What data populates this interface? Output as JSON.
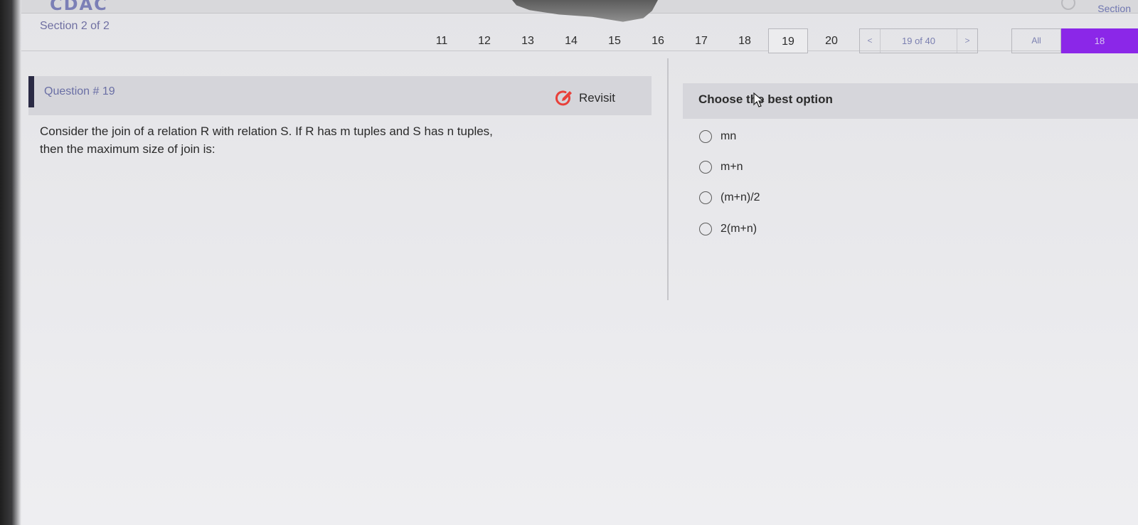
{
  "brand": {
    "logo_text": "CDAC"
  },
  "header": {
    "section_label": "Section 2 of 2",
    "section_right_label": "Section",
    "question_numbers": [
      "11",
      "12",
      "13",
      "14",
      "15",
      "16",
      "17",
      "18",
      "19",
      "20"
    ],
    "active_question": "19",
    "pager": {
      "prev": "<",
      "counter": "19 of 40",
      "next": ">"
    },
    "filter_label": "All",
    "count_value": "18"
  },
  "question": {
    "number_label": "Question # 19",
    "revisit_label": "Revisit",
    "text_line1": "Consider the join of a relation R with relation S. If R has m tuples and S has n tuples,",
    "text_line2": "then the maximum size of join is:"
  },
  "answer_panel": {
    "title": "Choose the best option",
    "options": [
      "mn",
      "m+n",
      "(m+n)/2",
      "2(m+n)"
    ]
  },
  "colors": {
    "accent_purple": "#8b27e8",
    "revisit_red": "#e8403a",
    "label_blue": "#6a6fa5"
  },
  "icons": {
    "revisit": "revisit-edit-icon",
    "cursor": "mouse-cursor-icon"
  }
}
